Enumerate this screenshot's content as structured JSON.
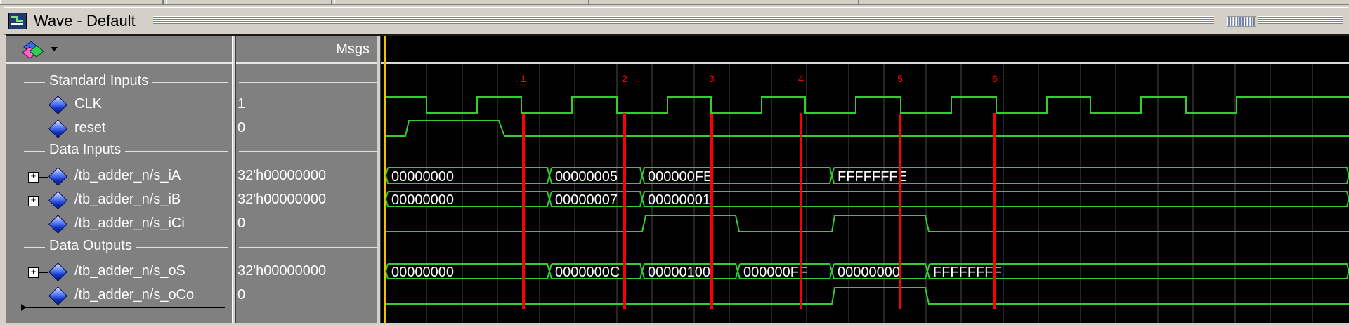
{
  "window": {
    "title": "Wave - Default"
  },
  "columns": {
    "messages_header": "Msgs"
  },
  "icons": {
    "app": "wave-window-icon",
    "toolbar": "signal-toolbar-icon",
    "signal": "signal-diamond-icon",
    "expand": "expand-plus-icon"
  },
  "colors": {
    "wave_green": "#33cc33",
    "bus_value_text": "#ffffff",
    "cursor_red": "#ff0000",
    "cursor_label": "#ff0000",
    "background": "#000000",
    "grid": "#4a4a4a"
  },
  "groups": [
    {
      "label": "Standard Inputs"
    },
    {
      "label": "Data Inputs"
    },
    {
      "label": "Data Outputs"
    }
  ],
  "signals": [
    {
      "name": "CLK",
      "value": "1",
      "kind": "bit",
      "expandable": false
    },
    {
      "name": "reset",
      "value": "0",
      "kind": "bit",
      "expandable": false
    },
    {
      "name": "/tb_adder_n/s_iA",
      "value": "32'h00000000",
      "kind": "bus",
      "expandable": true,
      "segments": [
        "00000000",
        "00000005",
        "000000FE",
        "FFFFFFFE"
      ]
    },
    {
      "name": "/tb_adder_n/s_iB",
      "value": "32'h00000000",
      "kind": "bus",
      "expandable": true,
      "segments": [
        "00000000",
        "00000007",
        "00000001"
      ]
    },
    {
      "name": "/tb_adder_n/s_iCi",
      "value": "0",
      "kind": "bit",
      "expandable": false
    },
    {
      "name": "/tb_adder_n/s_oS",
      "value": "32'h00000000",
      "kind": "bus",
      "expandable": true,
      "segments": [
        "00000000",
        "0000000C",
        "00000100",
        "000000FF",
        "00000000",
        "FFFFFFFF"
      ]
    },
    {
      "name": "/tb_adder_n/s_oCo",
      "value": "0",
      "kind": "bit",
      "expandable": false
    }
  ],
  "cursors": [
    "1",
    "2",
    "3",
    "4",
    "5",
    "6"
  ]
}
